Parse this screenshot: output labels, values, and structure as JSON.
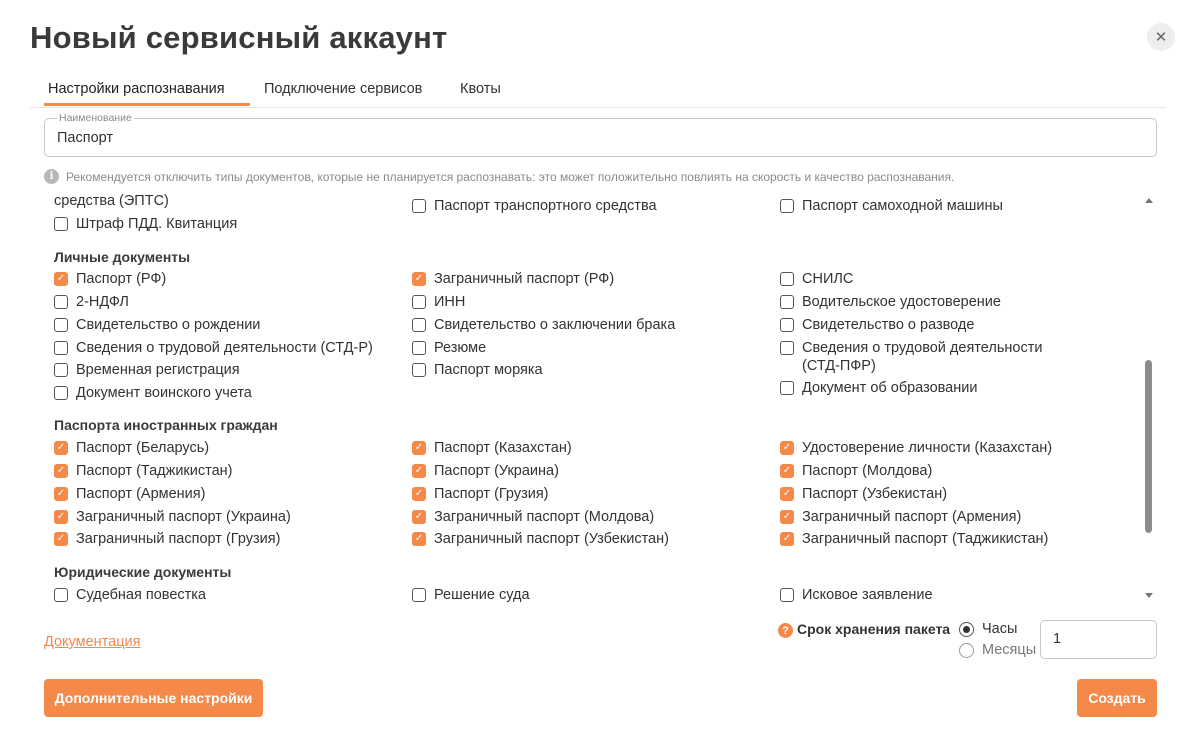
{
  "dialog": {
    "title": "Новый сервисный аккаунт",
    "close_glyph": "✕"
  },
  "tabs": [
    {
      "label": "Настройки распознавания",
      "active": true
    },
    {
      "label": "Подключение сервисов",
      "active": false
    },
    {
      "label": "Квоты",
      "active": false
    }
  ],
  "name_field": {
    "legend": "Наименование",
    "value": "Паспорт"
  },
  "hint": {
    "icon": "info-icon",
    "text": "Рекомендуется отключить типы документов, которые не планируется распознавать: это может положительно повлиять на скорость и качество распознавания."
  },
  "vehicle_partial": {
    "cut_text": "средства (ЭПТС)",
    "items": [
      {
        "label": "Штраф ПДД. Квитанция",
        "checked": false
      },
      {
        "label": "Паспорт транспортного средства",
        "checked": false
      },
      {
        "label": "Паспорт самоходной машины",
        "checked": false
      }
    ]
  },
  "groups": [
    {
      "title": "Личные документы",
      "items": [
        {
          "label": "Паспорт (РФ)",
          "checked": true
        },
        {
          "label": "Заграничный паспорт (РФ)",
          "checked": true
        },
        {
          "label": "СНИЛС",
          "checked": false
        },
        {
          "label": "2-НДФЛ",
          "checked": false
        },
        {
          "label": "ИНН",
          "checked": false
        },
        {
          "label": "Водительское удостоверение",
          "checked": false
        },
        {
          "label": "Свидетельство о рождении",
          "checked": false
        },
        {
          "label": "Свидетельство о заключении брака",
          "checked": false
        },
        {
          "label": "Свидетельство о разводе",
          "checked": false
        },
        {
          "label": "Сведения о трудовой деятельности (СТД-Р)",
          "checked": false
        },
        {
          "label": "Резюме",
          "checked": false
        },
        {
          "label": "Сведения о трудовой деятельности (СТД-ПФР)",
          "checked": false
        },
        {
          "label": "Временная регистрация",
          "checked": false
        },
        {
          "label": "Паспорт моряка",
          "checked": false
        },
        {
          "label": "Документ об образовании",
          "checked": false
        },
        {
          "label": "Документ воинского учета",
          "checked": false
        }
      ]
    },
    {
      "title": "Паспорта иностранных граждан",
      "items": [
        {
          "label": "Паспорт (Беларусь)",
          "checked": true
        },
        {
          "label": "Паспорт (Казахстан)",
          "checked": true
        },
        {
          "label": "Удостоверение личности (Казахстан)",
          "checked": true
        },
        {
          "label": "Паспорт (Таджикистан)",
          "checked": true
        },
        {
          "label": "Паспорт (Украина)",
          "checked": true
        },
        {
          "label": "Паспорт (Молдова)",
          "checked": true
        },
        {
          "label": "Паспорт (Армения)",
          "checked": true
        },
        {
          "label": "Паспорт (Грузия)",
          "checked": true
        },
        {
          "label": "Паспорт (Узбекистан)",
          "checked": true
        },
        {
          "label": "Заграничный паспорт (Украина)",
          "checked": true
        },
        {
          "label": "Заграничный паспорт (Молдова)",
          "checked": true
        },
        {
          "label": "Заграничный паспорт (Армения)",
          "checked": true
        },
        {
          "label": "Заграничный паспорт (Грузия)",
          "checked": true
        },
        {
          "label": "Заграничный паспорт (Узбекистан)",
          "checked": true
        },
        {
          "label": "Заграничный паспорт (Таджикистан)",
          "checked": true
        }
      ]
    },
    {
      "title": "Юридические документы",
      "items": [
        {
          "label": "Судебная повестка",
          "checked": false
        },
        {
          "label": "Решение суда",
          "checked": false
        },
        {
          "label": "Исковое заявление",
          "checked": false
        }
      ]
    }
  ],
  "footer": {
    "documentation_link": "Документация",
    "storage": {
      "icon": "question-icon",
      "label": "Срок хранения пакета",
      "options": [
        {
          "label": "Часы",
          "selected": true
        },
        {
          "label": "Месяцы",
          "selected": false
        }
      ],
      "value": "1"
    },
    "advanced_button": "Дополнительные настройки",
    "create_button": "Создать"
  },
  "colors": {
    "accent": "#f4894a",
    "text": "#333333",
    "muted": "#8a8a8a"
  }
}
